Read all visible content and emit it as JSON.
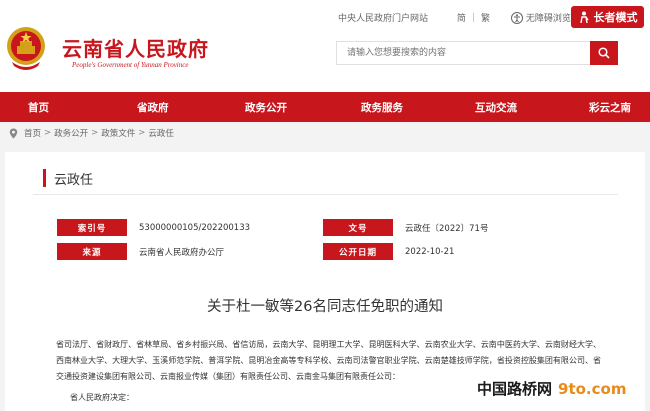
{
  "header": {
    "site_title": "云南省人民政府",
    "site_subtitle": "People's Government of Yunnan Province",
    "portal_link": "中央人民政府门户网站",
    "lang_simplified": "简",
    "lang_traditional": "繁",
    "accessibility": "无障碍浏览",
    "elder_mode": "长者模式",
    "search_placeholder": "请输入您想要搜索的内容"
  },
  "nav": {
    "items": [
      {
        "label": "首页"
      },
      {
        "label": "省政府"
      },
      {
        "label": "政务公开"
      },
      {
        "label": "政务服务"
      },
      {
        "label": "互动交流"
      },
      {
        "label": "彩云之南"
      }
    ]
  },
  "breadcrumb": {
    "items": [
      "首页",
      "政务公开",
      "政策文件",
      "云政任"
    ]
  },
  "doc": {
    "tag": "云政任",
    "index_label": "索引号",
    "index_value": "53000000105/202200133",
    "number_label": "文号",
    "number_value": "云政任〔2022〕71号",
    "source_label": "来源",
    "source_value": "云南省人民政府办公厅",
    "date_label": "公开日期",
    "date_value": "2022-10-21",
    "title": "关于杜一敏等26名同志任免职的通知",
    "body_line1": "省司法厅、省财政厅、省林草局、省乡村振兴局、省信访局，云南大学、昆明理工大学、昆明医科大学、云南农业大学、云南中医药大学、云南财经大学、西南林业大学、大理大学、玉溪师范学院、普洱学院、昆明冶金高等专科学校、云南司法警官职业学院、云南楚雄技师学院，省投资控股集团有限公司、省交通投资建设集团有限公司、云南报业传媒（集团）有限责任公司、云南金马集团有限责任公司：",
    "body_line2": "省人民政府决定："
  },
  "watermark": {
    "text1": "中国路桥网",
    "text2": "9to.com"
  },
  "colors": {
    "brand": "#c8161d",
    "watermark_orange": "#e98b1a"
  }
}
